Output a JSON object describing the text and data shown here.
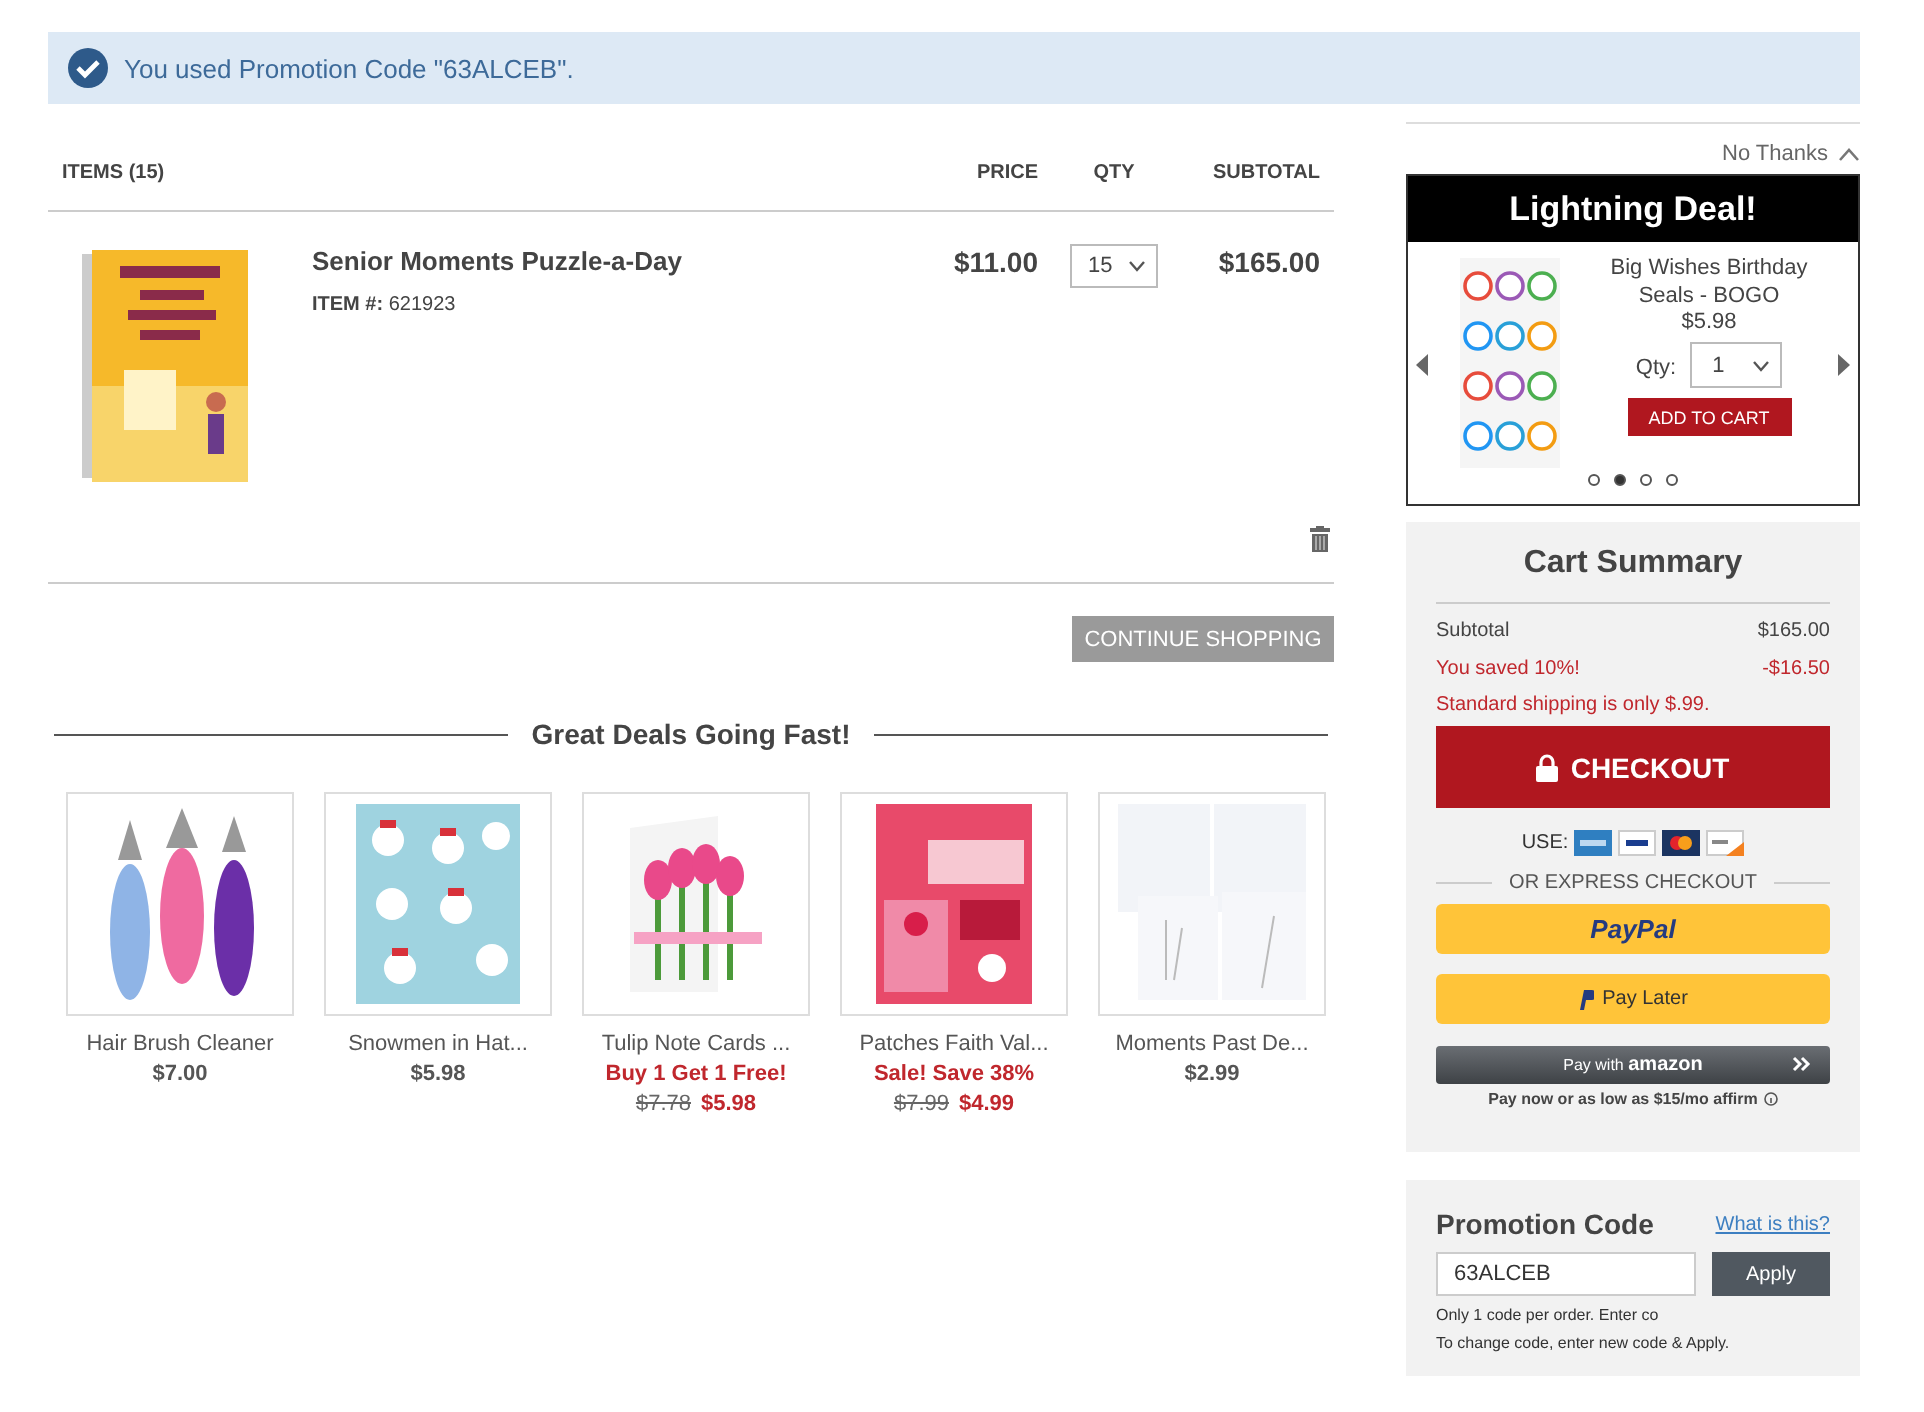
{
  "banner": {
    "text": "You used Promotion Code \"63ALCEB\"."
  },
  "cart": {
    "columns": [
      "ITEMS (15)",
      "PRICE",
      "QTY",
      "SUBTOTAL"
    ],
    "items": [
      {
        "title": "Senior Moments Puzzle-a-Day",
        "item_label": "ITEM #:",
        "item_number": "621923",
        "price": "$11.00",
        "qty": "15",
        "subtotal": "$165.00"
      }
    ],
    "continue_button": "CONTINUE SHOPPING"
  },
  "deals": {
    "heading": "Great Deals Going Fast!",
    "products": [
      {
        "kind": "regular",
        "name": "Hair Brush Cleaner",
        "price": "$7.00"
      },
      {
        "kind": "regular",
        "name": "Snowmen in Hat...",
        "price": "$5.98"
      },
      {
        "kind": "sale",
        "name": "Tulip Note Cards ...",
        "promo": "Buy 1 Get 1 Free!",
        "old_price": "$7.78",
        "price": "$5.98"
      },
      {
        "kind": "sale",
        "name": "Patches Faith Val...",
        "promo": "Sale! Save 38%",
        "old_price": "$7.99",
        "price": "$4.99"
      },
      {
        "kind": "regular",
        "name": "Moments Past De...",
        "price": "$2.99"
      }
    ]
  },
  "lightning_deal": {
    "dismiss": "No Thanks",
    "title": "Lightning Deal!",
    "product": "Big Wishes Birthday Seals - BOGO",
    "price": "$5.98",
    "qty_label": "Qty:",
    "qty": "1",
    "button": "ADD TO CART",
    "pages": [
      {
        "selected": false
      },
      {
        "selected": true
      },
      {
        "selected": false
      },
      {
        "selected": false
      }
    ]
  },
  "summary": {
    "title": "Cart Summary",
    "rows": [
      {
        "kind": "normal",
        "label": "Subtotal",
        "value": "$165.00"
      },
      {
        "kind": "discount",
        "label": "You saved 10%!",
        "value": "-$16.50"
      }
    ],
    "shipping_note": "Standard shipping is only $.99.",
    "checkout": "CHECKOUT",
    "use_label": "USE:",
    "express_label": "OR EXPRESS CHECKOUT",
    "paypal": "PayPal",
    "pay_later": "Pay Later",
    "amazon": "Pay with **amazon**",
    "affirm": "Pay now or as low as $15/mo **affirm**"
  },
  "promotion": {
    "title": "Promotion Code",
    "help_link": "What is this?",
    "value": "63ALCEB",
    "apply": "Apply",
    "notes": [
      "Only 1 code per order. Enter co",
      "To change code, enter new code & Apply."
    ]
  }
}
